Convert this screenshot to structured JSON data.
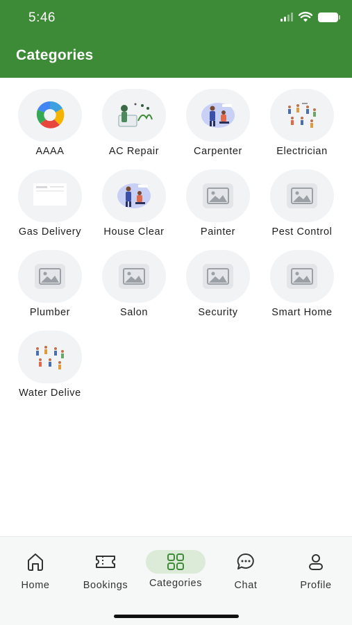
{
  "status_bar": {
    "time": "5:46"
  },
  "header": {
    "title": "Categories"
  },
  "categories": [
    {
      "label": "AAAA",
      "icon": "aaaa-logo-icon"
    },
    {
      "label": "AC Repair",
      "icon": "ac-repair-illustration"
    },
    {
      "label": "Carpenter",
      "icon": "carpenter-illustration"
    },
    {
      "label": "Electrician",
      "icon": "electrician-illustration"
    },
    {
      "label": "Gas Delivery",
      "icon": "gas-delivery-illustration"
    },
    {
      "label": "House Clear",
      "icon": "house-clear-illustration"
    },
    {
      "label": "Painter",
      "icon": "image-placeholder-icon"
    },
    {
      "label": "Pest Control",
      "icon": "image-placeholder-icon"
    },
    {
      "label": "Plumber",
      "icon": "image-placeholder-icon"
    },
    {
      "label": "Salon",
      "icon": "image-placeholder-icon"
    },
    {
      "label": "Security",
      "icon": "image-placeholder-icon"
    },
    {
      "label": "Smart Home",
      "icon": "image-placeholder-icon"
    },
    {
      "label": "Water Delive",
      "icon": "water-delivery-illustration"
    }
  ],
  "tabbar": {
    "items": [
      {
        "label": "Home",
        "icon": "home-icon"
      },
      {
        "label": "Bookings",
        "icon": "ticket-icon"
      },
      {
        "label": "Categories",
        "icon": "grid-icon",
        "active": true
      },
      {
        "label": "Chat",
        "icon": "chat-bubble-icon"
      },
      {
        "label": "Profile",
        "icon": "person-icon"
      }
    ]
  },
  "colors": {
    "primary": "#3d8b36",
    "active_pill": "#dcebd8",
    "circle_bg": "#f2f3f5"
  }
}
